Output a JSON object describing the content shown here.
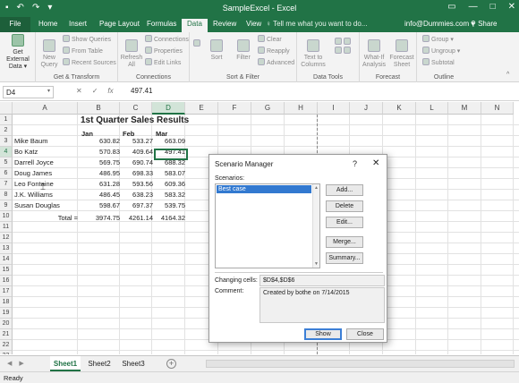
{
  "window": {
    "title": "SampleExcel - Excel",
    "user": "info@Dummies.com",
    "share_label": "Share",
    "tell_me": "Tell me what you want to do..."
  },
  "ribbon": {
    "tabs": [
      "File",
      "Home",
      "Insert",
      "Page Layout",
      "Formulas",
      "Data",
      "Review",
      "View"
    ],
    "active_tab": "Data",
    "groups": {
      "get_transform": {
        "label": "Get & Transform",
        "get_external_data": "Get External Data",
        "new_query": "New Query",
        "show_queries": "Show Queries",
        "from_table": "From Table",
        "recent_sources": "Recent Sources"
      },
      "connections": {
        "label": "Connections",
        "refresh_all": "Refresh All",
        "connections": "Connections",
        "properties": "Properties",
        "edit_links": "Edit Links"
      },
      "sort_filter": {
        "label": "Sort & Filter",
        "sort": "Sort",
        "filter": "Filter",
        "clear": "Clear",
        "reapply": "Reapply",
        "advanced": "Advanced"
      },
      "data_tools": {
        "label": "Data Tools",
        "text_to_columns": "Text to Columns"
      },
      "forecast": {
        "label": "Forecast",
        "what_if": "What-If Analysis",
        "forecast_sheet": "Forecast Sheet"
      },
      "outline": {
        "label": "Outline",
        "group": "Group",
        "ungroup": "Ungroup",
        "subtotal": "Subtotal"
      }
    }
  },
  "formula_bar": {
    "name_box": "D4",
    "formula": "497.41"
  },
  "sheet": {
    "columns": [
      "A",
      "B",
      "C",
      "D",
      "E",
      "F",
      "G",
      "H",
      "I",
      "J",
      "K",
      "L",
      "M",
      "N"
    ],
    "rows": [
      "1",
      "2",
      "3",
      "4",
      "5",
      "6",
      "7",
      "8",
      "9",
      "10",
      "11",
      "12",
      "13",
      "14",
      "15",
      "16",
      "17",
      "18",
      "19",
      "20",
      "21",
      "22",
      "23"
    ],
    "title": "1st Quarter Sales Results",
    "headers": [
      "Jan",
      "Feb",
      "Mar"
    ],
    "data": [
      {
        "name": "Mike Baum",
        "jan": "630.82",
        "feb": "533.27",
        "mar": "663.09"
      },
      {
        "name": "Bo Katz",
        "jan": "570.83",
        "feb": "409.64",
        "mar": "497.41"
      },
      {
        "name": "Darrell Joyce",
        "jan": "569.75",
        "feb": "690.74",
        "mar": "688.32"
      },
      {
        "name": "Doug James",
        "jan": "486.95",
        "feb": "698.33",
        "mar": "583.07"
      },
      {
        "name": "Leo Fontaine",
        "jan": "631.28",
        "feb": "593.56",
        "mar": "609.36"
      },
      {
        "name": "J.K. Williams",
        "jan": "486.45",
        "feb": "638.23",
        "mar": "583.32"
      },
      {
        "name": "Susan Douglas",
        "jan": "598.67",
        "feb": "697.37",
        "mar": "539.75"
      }
    ],
    "total": {
      "label": "Total =",
      "jan": "3974.75",
      "feb": "4261.14",
      "mar": "4164.32"
    }
  },
  "sheet_tabs": [
    "Sheet1",
    "Sheet2",
    "Sheet3"
  ],
  "status": "Ready",
  "dialog": {
    "title": "Scenario Manager",
    "help": "?",
    "close": "✕",
    "scenarios_label": "Scenarios:",
    "scenarios": [
      "Best case"
    ],
    "add": "Add...",
    "delete": "Delete",
    "edit": "Edit...",
    "merge": "Merge...",
    "summary": "Summary...",
    "changing_cells_label": "Changing cells:",
    "changing_cells": "$D$4,$D$6",
    "comment_label": "Comment:",
    "comment": "Created by bothe on 7/14/2015",
    "show": "Show",
    "close_button": "Close"
  }
}
